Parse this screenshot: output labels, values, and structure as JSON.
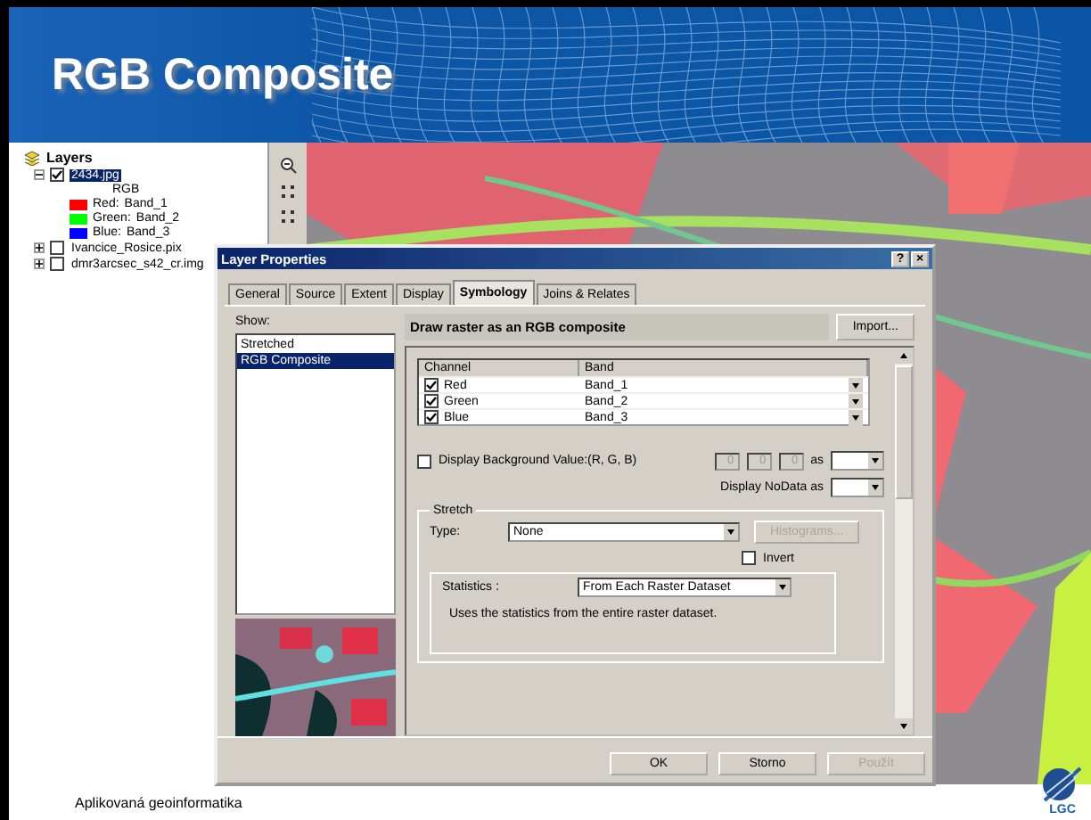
{
  "slide": {
    "title": "RGB Composite",
    "footer": "Aplikovaná geoinformatika",
    "logo_text": "LGC"
  },
  "toc": {
    "root": "Layers",
    "layers": [
      {
        "name": "2434.jpg",
        "checked": true,
        "expanded": true,
        "selected": true,
        "legend_title": "RGB",
        "legend": [
          {
            "label": "Red:",
            "band": "Band_1",
            "color": "#ff0000"
          },
          {
            "label": "Green:",
            "band": "Band_2",
            "color": "#00ff00"
          },
          {
            "label": "Blue:",
            "band": "Band_3",
            "color": "#0000ff"
          }
        ]
      },
      {
        "name": "Ivancice_Rosice.pix",
        "checked": false,
        "expanded": false,
        "selected": false
      },
      {
        "name": "dmr3arcsec_s42_cr.img",
        "checked": false,
        "expanded": false,
        "selected": false
      }
    ]
  },
  "dialog": {
    "title": "Layer Properties",
    "help": "?",
    "close": "×",
    "tabs": [
      {
        "label": "General",
        "selected": false
      },
      {
        "label": "Source",
        "selected": false
      },
      {
        "label": "Extent",
        "selected": false
      },
      {
        "label": "Display",
        "selected": false
      },
      {
        "label": "Symbology",
        "selected": true
      },
      {
        "label": "Joins & Relates",
        "selected": false
      }
    ],
    "show_label": "Show:",
    "show_items": [
      {
        "label": "Stretched",
        "selected": false
      },
      {
        "label": "RGB Composite",
        "selected": true
      }
    ],
    "heading": "Draw raster as an RGB composite",
    "import": "Import...",
    "columns": [
      "Channel",
      "Band"
    ],
    "rows": [
      {
        "channel": "Red",
        "band": "Band_1",
        "checked": true
      },
      {
        "channel": "Green",
        "band": "Band_2",
        "checked": true
      },
      {
        "channel": "Blue",
        "band": "Band_3",
        "checked": true
      }
    ],
    "background": {
      "label": "Display Background Value:(R, G, B)",
      "checked": false,
      "values": [
        "0",
        "0",
        "0"
      ],
      "as": "as"
    },
    "nodata_label": "Display NoData as",
    "stretch": {
      "title": "Stretch",
      "type_label": "Type:",
      "type": "None",
      "histograms": "Histograms...",
      "histograms_disabled": true,
      "invert": "Invert",
      "invert_checked": false,
      "statistics_label": "Statistics :",
      "statistics": "From Each Raster Dataset",
      "description": "Uses the statistics from the entire raster dataset."
    },
    "buttons": [
      {
        "label": "OK",
        "disabled": false
      },
      {
        "label": "Storno",
        "disabled": false
      },
      {
        "label": "Použít",
        "disabled": true
      }
    ]
  }
}
